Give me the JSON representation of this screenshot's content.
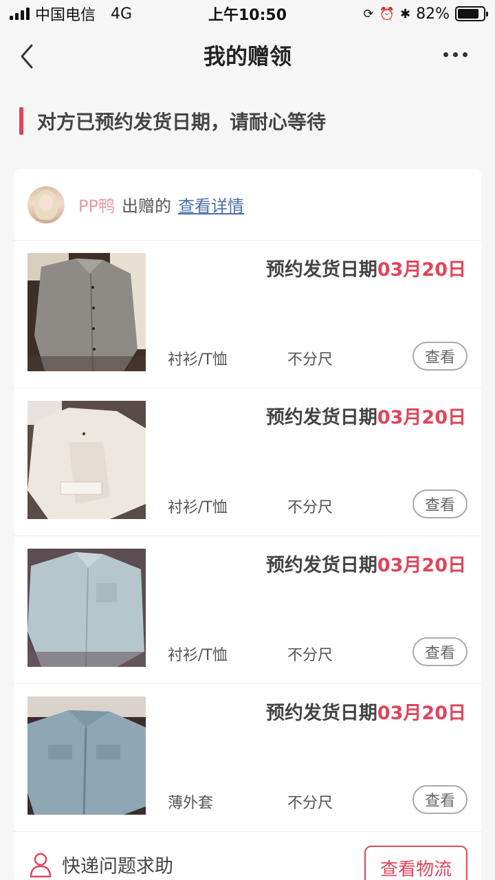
{
  "status_bar": {
    "carrier": "中国电信",
    "network": "4G",
    "time": "上午10:50",
    "battery": "82%",
    "battery_level": 0.82
  },
  "nav": {
    "title": "我的赠领",
    "back_icon": "chevron-left-icon",
    "more_icon": "more-dots-icon"
  },
  "notice": {
    "text": "对方已预约发货日期，请耐心等待",
    "accent": "#e0455b"
  },
  "giver": {
    "name": "PP鸭",
    "action_text": "出赠的",
    "link_text": "查看详情"
  },
  "items": [
    {
      "ship_label": "预约发货日期",
      "ship_date": "03月20日",
      "category": "衬衫/T恤",
      "size": "不分尺",
      "view_label": "查看",
      "image": "gray-shirt"
    },
    {
      "ship_label": "预约发货日期",
      "ship_date": "03月20日",
      "category": "衬衫/T恤",
      "size": "不分尺",
      "view_label": "查看",
      "image": "white-shirt"
    },
    {
      "ship_label": "预约发货日期",
      "ship_date": "03月20日",
      "category": "衬衫/T恤",
      "size": "不分尺",
      "view_label": "查看",
      "image": "light-denim-shirt"
    },
    {
      "ship_label": "预约发货日期",
      "ship_date": "03月20日",
      "category": "薄外套",
      "size": "不分尺",
      "view_label": "查看",
      "image": "denim-jacket"
    }
  ],
  "footer": {
    "help_text": "快递问题求助",
    "help_icon": "user-icon",
    "logistics_label": "查看物流"
  },
  "colors": {
    "accent_red": "#e0455b",
    "link_blue": "#4a6ea8",
    "giver_pink": "#e89aa3"
  }
}
